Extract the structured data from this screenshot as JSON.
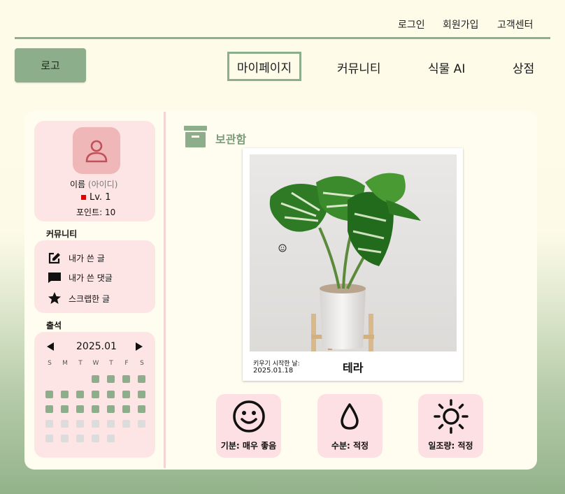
{
  "header": {
    "top_links": [
      "로그인",
      "회원가입",
      "고객센터"
    ],
    "logo_label": "로고",
    "nav": [
      {
        "label": "마이페이지",
        "active": true
      },
      {
        "label": "커뮤니티",
        "active": false
      },
      {
        "label": "식물 AI",
        "active": false
      },
      {
        "label": "상점",
        "active": false
      }
    ]
  },
  "profile": {
    "name": "이름",
    "id": "(아이디)",
    "level": "Lv. 1",
    "points": "포인트: 10"
  },
  "community": {
    "title": "커뮤니티",
    "items": [
      {
        "label": "내가 쓴 글",
        "icon": "edit-icon"
      },
      {
        "label": "내가 쓴 댓글",
        "icon": "comment-icon"
      },
      {
        "label": "스크랩한 글",
        "icon": "star-icon"
      }
    ]
  },
  "attendance": {
    "title": "출석",
    "month": "2025.01",
    "weekdays": [
      "S",
      "M",
      "T",
      "W",
      "T",
      "F",
      "S"
    ]
  },
  "storage": {
    "title": "보관함",
    "plant_name": "테라",
    "start_label": "키우기 시작한 날:",
    "start_date": "2025.01.18"
  },
  "stats": [
    {
      "label": "기분: 매우 좋음",
      "icon": "smile-icon"
    },
    {
      "label": "수분: 적정",
      "icon": "water-drop-icon"
    },
    {
      "label": "일조량: 적정",
      "icon": "sun-icon"
    }
  ],
  "colors": {
    "accent": "#8dae8b",
    "pink": "#fde5e6",
    "avatar": "#efb7b8",
    "level_badge": "#e00000"
  }
}
